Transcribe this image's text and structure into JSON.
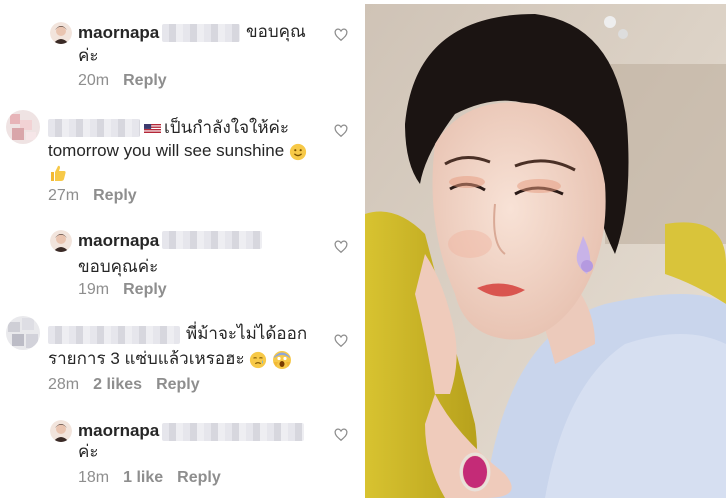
{
  "comments": [
    {
      "username": "maornapa",
      "line1_suffix": "ขอบคุณ",
      "line2": "ค่ะ",
      "time": "20m",
      "likes": "",
      "reply": "Reply"
    },
    {
      "line1": "เป็นกำลังใจให้ค่ะ",
      "line2": "tomorrow you will see sunshine",
      "time": "27m",
      "likes": "",
      "reply": "Reply",
      "icons": [
        "us-flag-icon",
        "smiling-face-icon",
        "thumbs-up-icon"
      ]
    },
    {
      "username": "maornapa",
      "line2": "ขอบคุณค่ะ",
      "time": "19m",
      "likes": "",
      "reply": "Reply"
    },
    {
      "line1": "พี่ม้าจะไม่ได้ออก",
      "line2": "รายการ 3 แซ่บแล้วเหรอฮะ",
      "time": "28m",
      "likes": "2 likes",
      "reply": "Reply",
      "icons": [
        "sad-relieved-face-icon",
        "screaming-face-icon"
      ]
    },
    {
      "username": "maornapa",
      "line2": "ค่ะ",
      "time": "18m",
      "likes": "1 like",
      "reply": "Reply"
    }
  ],
  "colors": {
    "text": "#262626",
    "meta": "#8e8e8e",
    "blur": "#dcdce2"
  }
}
